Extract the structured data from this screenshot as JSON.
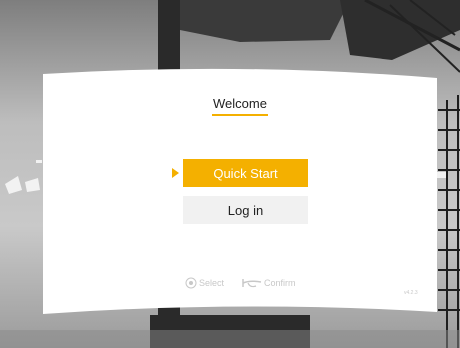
{
  "welcome": {
    "title": "Welcome",
    "quick_start_label": "Quick Start",
    "login_label": "Log in"
  },
  "hints": {
    "select_label": "Select",
    "confirm_label": "Confirm"
  },
  "version": "v4.2.3",
  "colors": {
    "accent": "#f4b000",
    "panel": "#ffffff",
    "secondary_button": "#f1f1f1",
    "hint_text": "#c8c8c8"
  },
  "icons": {
    "pointer": "arrow-right-icon",
    "select": "gamepad-button-icon",
    "confirm": "trigger-icon"
  }
}
